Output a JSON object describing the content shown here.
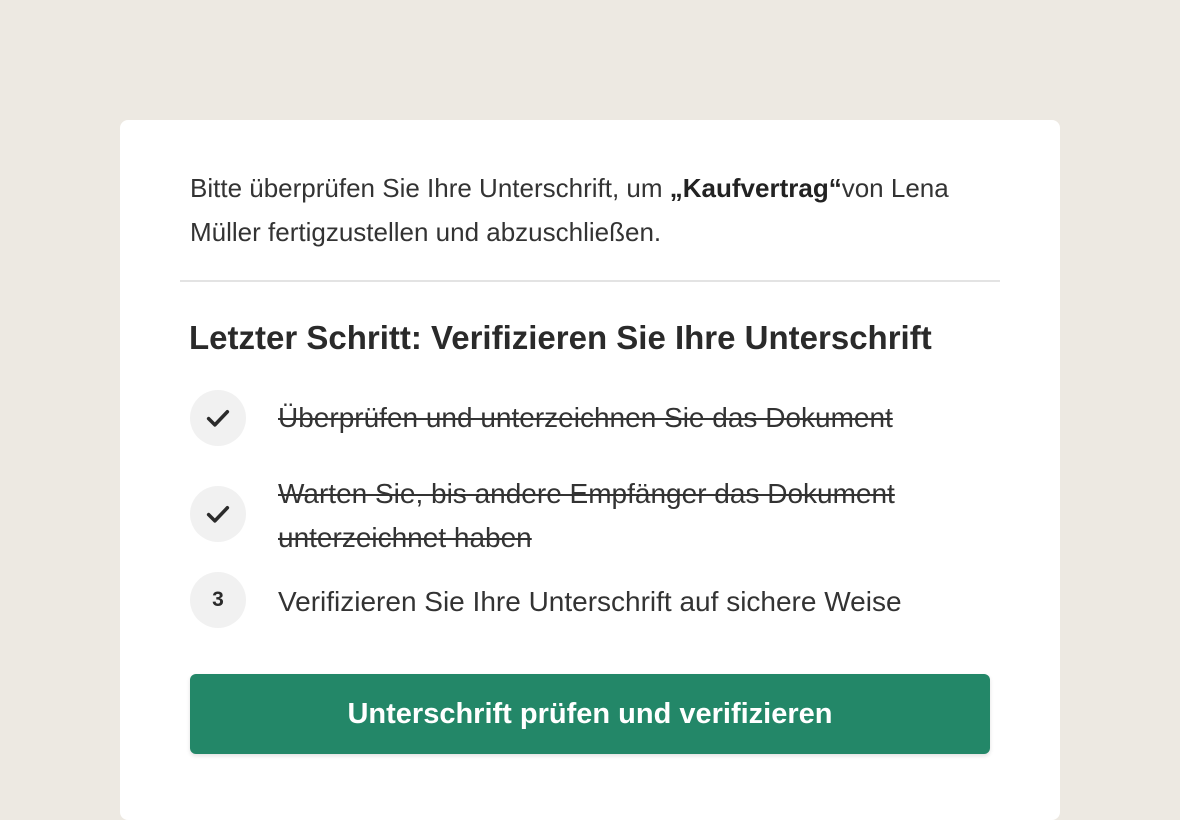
{
  "intro": {
    "text_before": "Bitte überprüfen Sie Ihre Unterschrift, um ",
    "document_name": "„Kaufvertrag“",
    "text_after": "von Lena Müller fertigzustellen und abzuschließen."
  },
  "step_title": "Letzter Schritt: Verifizieren Sie Ihre Unterschrift",
  "steps": [
    {
      "status": "done",
      "icon": "check-icon",
      "label": "Überprüfen und unterzeichnen Sie das Dokument"
    },
    {
      "status": "done",
      "icon": "check-icon",
      "label": "Warten Sie, bis andere Empfänger das Dokument unterzeichnet haben"
    },
    {
      "status": "current",
      "number": "3",
      "label": "Verifizieren Sie Ihre Unterschrift auf sichere Weise"
    }
  ],
  "primary_button": {
    "label": "Unterschrift prüfen und verifizieren"
  },
  "colors": {
    "background": "#ede9e2",
    "card": "#ffffff",
    "accent": "#238768",
    "badge_bg": "#f1f1f1",
    "text": "#2b2b2b"
  }
}
